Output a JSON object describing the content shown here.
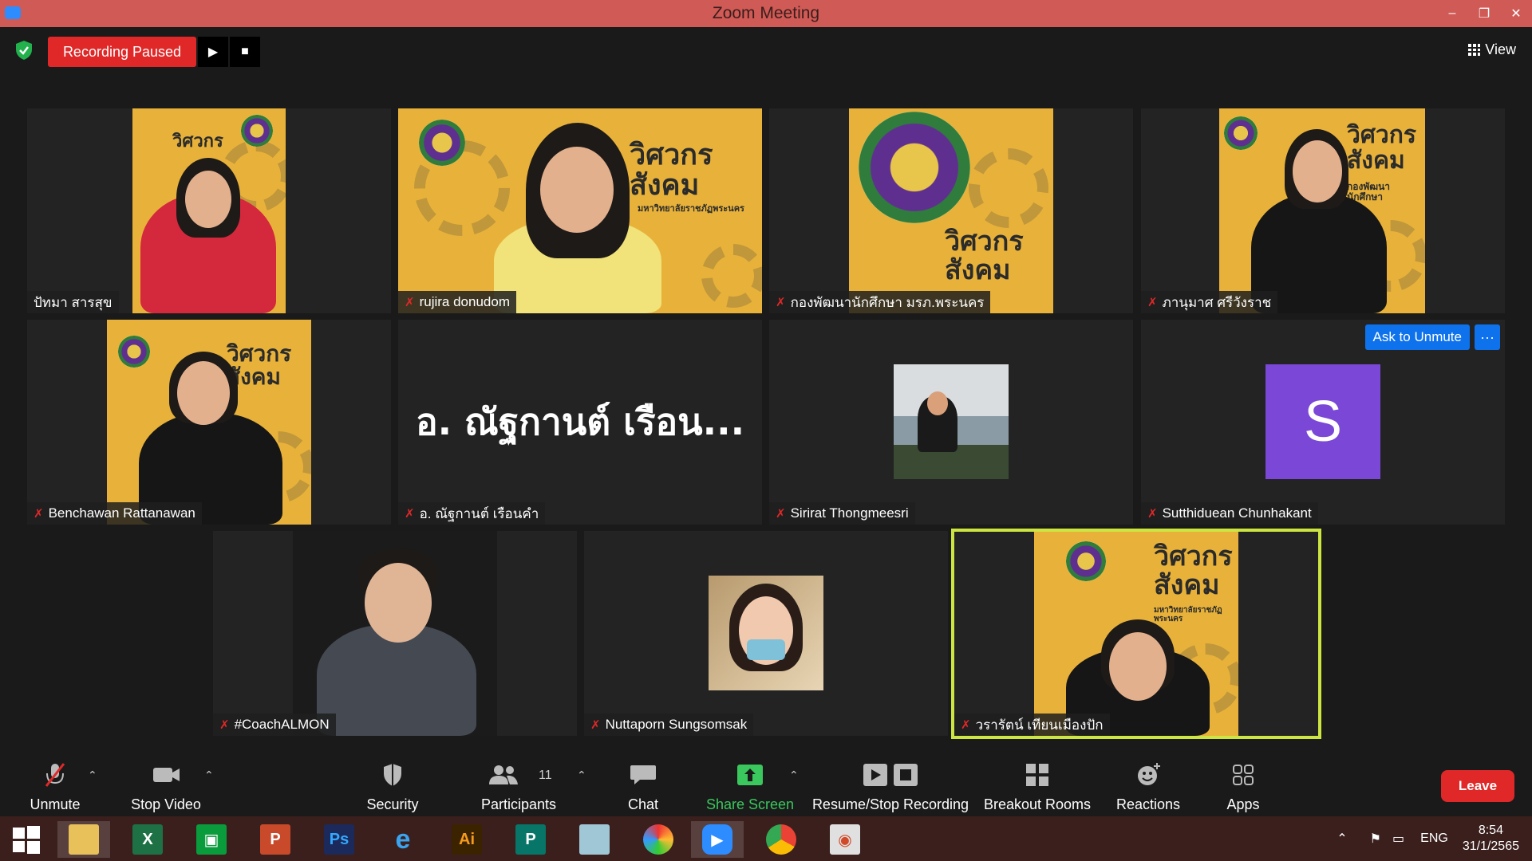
{
  "window": {
    "title": "Zoom Meeting",
    "minimize": "–",
    "restore": "❐",
    "close": "✕"
  },
  "topbar": {
    "recording_label": "Recording Paused",
    "resume_icon": "▶",
    "stop_icon": "■",
    "view_label": "View"
  },
  "participants": [
    {
      "name": "ปัทมา สารสุข",
      "muted": false
    },
    {
      "name": "rujira donudom",
      "muted": true
    },
    {
      "name": "กองพัฒนานักศึกษา มรภ.พระนคร",
      "muted": true
    },
    {
      "name": "ภานุมาศ ศรีวังราช",
      "muted": true
    },
    {
      "name": "Benchawan Rattanawan",
      "muted": true
    },
    {
      "name": "อ. ณัฐกานต์ เรือนคำ",
      "muted": true,
      "display_text": "อ. ณัฐกานต์ เรือน..."
    },
    {
      "name": "Sirirat Thongmeesri",
      "muted": true
    },
    {
      "name": "Sutthiduean Chunhakant",
      "muted": true,
      "avatar_letter": "S",
      "ask_unmute_label": "Ask to Unmute",
      "more_label": "···"
    },
    {
      "name": "#CoachALMON",
      "muted": true
    },
    {
      "name": "Nuttaporn Sungsomsak",
      "muted": true
    },
    {
      "name": "วรารัตน์ เทียนเมืองปัก",
      "muted": true
    }
  ],
  "branding": {
    "line1": "วิศวกร",
    "line2": "สังคม",
    "org": "กองพัฒนานักศึกษา",
    "uni": "มหาวิทยาลัยราชภัฏพระนคร"
  },
  "toolbar": {
    "unmute": "Unmute",
    "stop_video": "Stop Video",
    "security": "Security",
    "participants": "Participants",
    "participants_count": "11",
    "chat": "Chat",
    "share_screen": "Share Screen",
    "recording": "Resume/Stop Recording",
    "breakout": "Breakout Rooms",
    "reactions": "Reactions",
    "apps": "Apps",
    "leave": "Leave"
  },
  "taskbar": {
    "language": "ENG",
    "time": "8:54",
    "date": "31/1/2565",
    "apps": [
      "windows-start",
      "file-explorer",
      "excel",
      "store",
      "powerpoint",
      "photoshop",
      "internet-explorer",
      "illustrator",
      "publisher",
      "notepad",
      "photoscape",
      "zoom",
      "chrome",
      "photos"
    ]
  },
  "colors": {
    "titlebar": "#d05a55",
    "recording": "#e02828",
    "accent_blue": "#0e72ed",
    "active_speaker": "#cde541",
    "avatar": "#7b47d6",
    "brand_yellow": "#e8b23a"
  }
}
